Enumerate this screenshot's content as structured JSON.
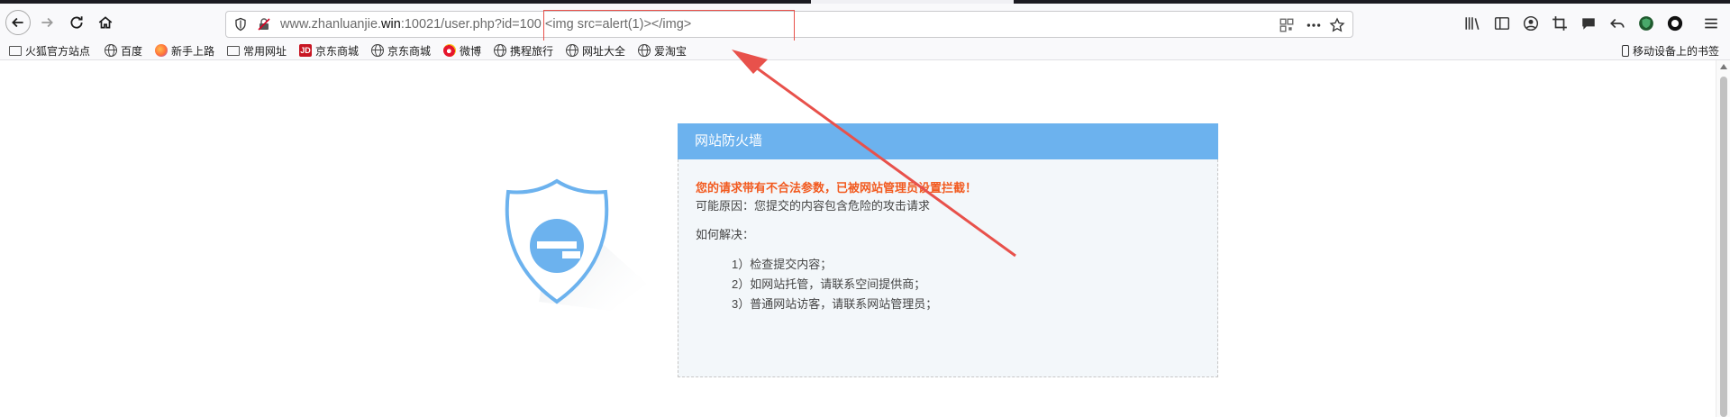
{
  "browser": {
    "url_host": "www.zhanluanjie.",
    "url_host_bold": "win",
    "url_rest": ":10021/user.php?id=100  <img src=alert(1)></img>"
  },
  "bookmarks": {
    "items": [
      {
        "label": "火狐官方站点",
        "icon": "folder-icon"
      },
      {
        "label": "百度",
        "icon": "globe-icon"
      },
      {
        "label": "新手上路",
        "icon": "firefox-icon"
      },
      {
        "label": "常用网址",
        "icon": "folder-icon"
      },
      {
        "label": "京东商城",
        "icon": "jd-icon"
      },
      {
        "label": "京东商城",
        "icon": "globe-icon"
      },
      {
        "label": "微博",
        "icon": "weibo-icon"
      },
      {
        "label": "携程旅行",
        "icon": "globe-icon"
      },
      {
        "label": "网址大全",
        "icon": "globe-icon"
      },
      {
        "label": "爱淘宝",
        "icon": "globe-icon"
      }
    ],
    "mobile": "移动设备上的书签"
  },
  "firewall": {
    "title": "网站防火墙",
    "warning": "您的请求带有不合法参数，已被网站管理员设置拦截！",
    "reason": "可能原因：您提交的内容包含危险的攻击请求",
    "solve_label": "如何解决：",
    "steps": [
      "1）检查提交内容；",
      "2）如网站托管，请联系空间提供商；",
      "3）普通网站访客，请联系网站管理员；"
    ]
  },
  "colors": {
    "header_blue": "#6cb2ee",
    "warning_orange": "#f25a1f",
    "annotation_red": "#e8514b"
  }
}
